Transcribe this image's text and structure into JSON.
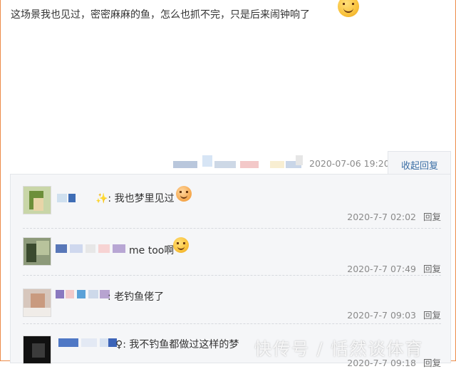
{
  "post": {
    "text": "这场景我也见过，密密麻麻的鱼，怎么也抓不完，只是后来闹钟响了",
    "emoji": "grin-emoji",
    "time": "2020-07-06 19:20",
    "collapse_reply_label": "收起回复"
  },
  "comments": [
    {
      "text": "✨: 我也梦里见过",
      "emoji": "laugh-tears-emoji",
      "time": "2020-7-7 02:02",
      "reply_label": "回复"
    },
    {
      "text": "me too啊",
      "emoji": "smile-emoji",
      "time": "2020-7-7 07:49",
      "reply_label": "回复"
    },
    {
      "text": ": 老钓鱼佬了",
      "time": "2020-7-7 09:03",
      "reply_label": "回复"
    },
    {
      "text": "♀: 我不钓鱼都做过这样的梦",
      "time": "2020-7-7 09:18",
      "reply_label": "回复"
    }
  ],
  "watermark": "快传号 / 恬然谈体育",
  "colors": {
    "border_accent": "#ec8b48",
    "link": "#3a6ea5",
    "panel_bg": "#f5f6f8",
    "meta": "#8a8a8a"
  }
}
